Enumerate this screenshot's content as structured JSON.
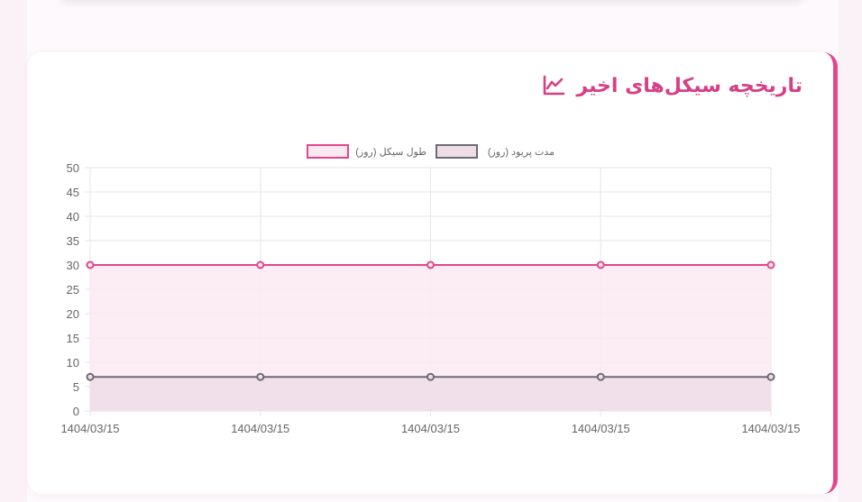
{
  "card": {
    "title": "تاریخچه سیکل‌های اخیر",
    "title_icon": "line-chart-icon"
  },
  "colors": {
    "accent": "#e2478c",
    "cycle_line": "#e2478c",
    "cycle_fill": "#fbe9f1",
    "period_line": "#6b6b78",
    "period_fill": "#efdde6",
    "grid": "#e6e6e6",
    "tick_text": "#666666"
  },
  "chart_data": {
    "type": "line",
    "x": [
      "1404/03/15",
      "1404/03/15",
      "1404/03/15",
      "1404/03/15",
      "1404/03/15"
    ],
    "series": [
      {
        "name": "طول سیکل (روز)",
        "values": [
          30,
          30,
          30,
          30,
          30
        ],
        "color": "#e2478c",
        "fill": "#fbe9f1"
      },
      {
        "name": "مدت پریود (روز)",
        "values": [
          7,
          7,
          7,
          7,
          7
        ],
        "color": "#6b6b78",
        "fill": "#efdde6"
      }
    ],
    "ylim": [
      0,
      50
    ],
    "yticks": [
      0,
      5,
      10,
      15,
      20,
      25,
      30,
      35,
      40,
      45,
      50
    ],
    "grid": true,
    "legend": "top-center",
    "title": "",
    "xlabel": "",
    "ylabel": ""
  }
}
